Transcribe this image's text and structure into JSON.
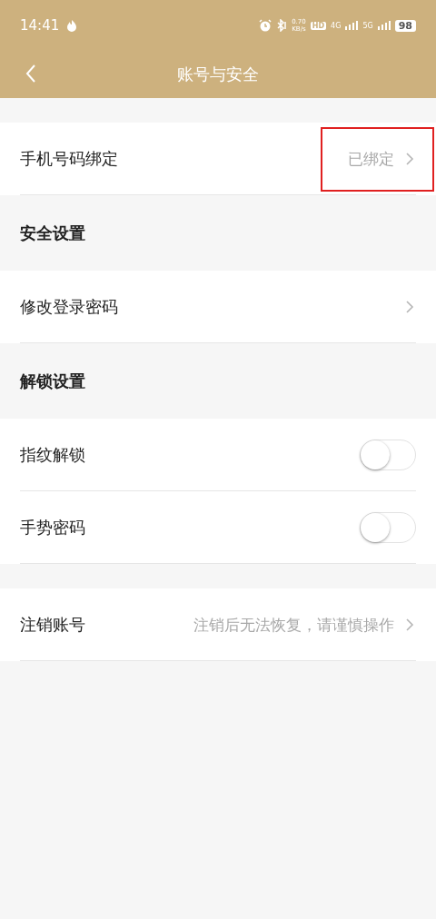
{
  "status_bar": {
    "time": "14:41",
    "speed_value": "0.70",
    "speed_unit": "KB/s",
    "hd": "HD",
    "net_1": "4G",
    "net_2": "5G",
    "battery": "98"
  },
  "nav": {
    "title": "账号与安全"
  },
  "groups": [
    {
      "rows": [
        {
          "kind": "link",
          "label": "手机号码绑定",
          "value": "已绑定",
          "highlighted": true
        }
      ]
    },
    {
      "header": "安全设置",
      "rows": [
        {
          "kind": "link",
          "label": "修改登录密码",
          "highlighted": false
        }
      ]
    },
    {
      "header": "解锁设置",
      "rows": [
        {
          "kind": "toggle",
          "label": "指纹解锁",
          "on": false
        },
        {
          "kind": "toggle",
          "label": "手势密码",
          "on": false
        }
      ]
    },
    {
      "rows": [
        {
          "kind": "link",
          "label": "注销账号",
          "value": "注销后无法恢复，请谨慎操作",
          "highlighted": false
        }
      ]
    }
  ]
}
